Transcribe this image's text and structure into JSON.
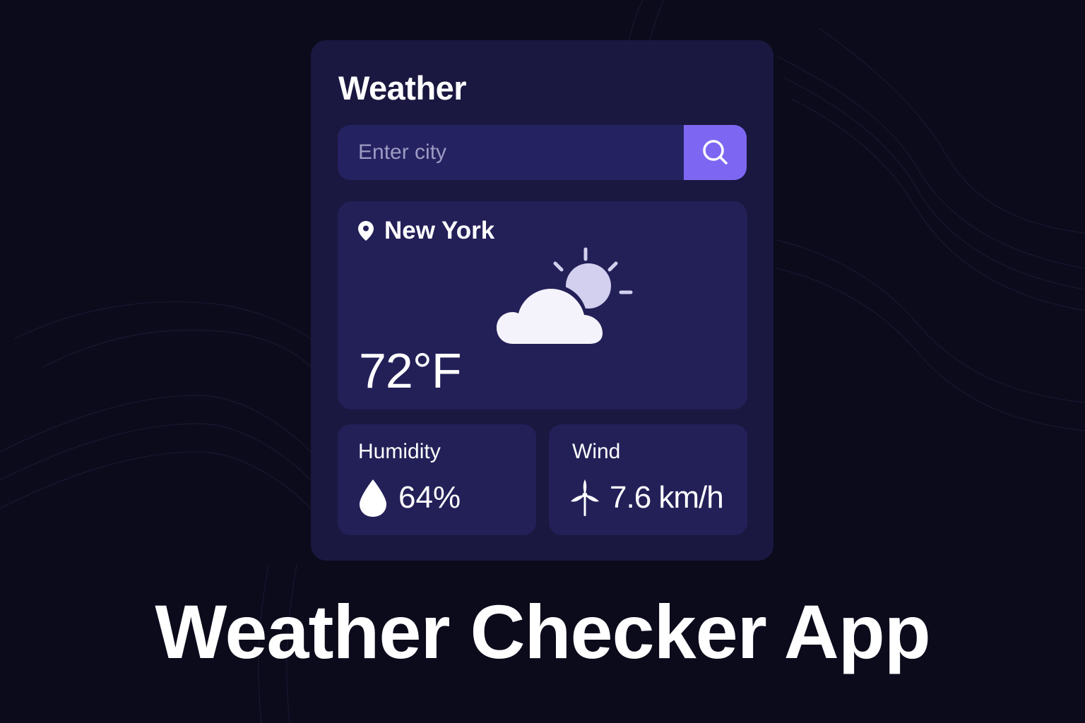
{
  "app": {
    "title": "Weather"
  },
  "search": {
    "placeholder": "Enter city",
    "button_icon": "search-icon"
  },
  "current": {
    "location_icon": "map-pin-icon",
    "city": "New York",
    "condition_icon": "partly-cloudy-icon",
    "temperature": "72°F"
  },
  "stats": {
    "humidity": {
      "label": "Humidity",
      "icon": "water-drop-icon",
      "value": "64%"
    },
    "wind": {
      "label": "Wind",
      "icon": "wind-turbine-icon",
      "value": "7.6 km/h"
    }
  },
  "footer": {
    "title": "Weather Checker App"
  },
  "colors": {
    "background": "#0b0b1c",
    "card": "#1a1840",
    "panel": "#232058",
    "accent": "#7d67f2",
    "text": "#ffffff",
    "placeholder": "#9d9bc4"
  }
}
